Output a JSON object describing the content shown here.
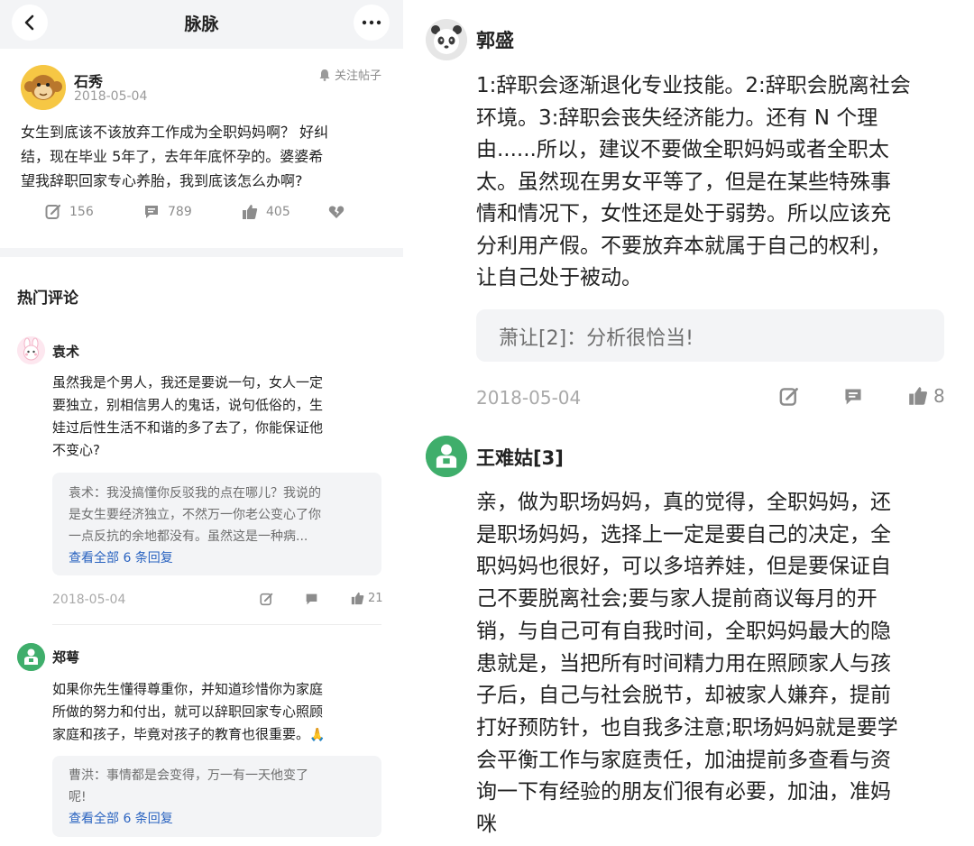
{
  "nav": {
    "title": "脉脉",
    "back_icon": "chevron-left-icon",
    "more_icon": "more-icon"
  },
  "post": {
    "author": "石秀",
    "date": "2018-05-04",
    "follow_label": "关注帖子",
    "lines": [
      "女生到底该不该放弃工作成为全职妈妈啊？ 好纠",
      "结，现在毕业 5年了，去年年底怀孕的。婆婆希",
      "望我辞职回家专心养胎，我到底该怎么办啊?"
    ],
    "stats": {
      "shares": "156",
      "comments": "789",
      "likes": "405"
    }
  },
  "hot_comments_title": "热门评论",
  "comments": [
    {
      "author": "袁术",
      "lines": [
        "虽然我是个男人，我还是要说一句，女人一定",
        "要独立，别相信男人的鬼话，说句低俗的，生",
        "娃过后性生活不和谐的多了去了，你能保证他",
        "不变心?"
      ],
      "reply_lines": [
        "袁术：我没搞懂你反驳我的点在哪儿？我说的",
        "是女生要经济独立，不然万一你老公变心了你",
        "一点反抗的余地都没有。虽然这是一种病..."
      ],
      "view_all": "查看全部 6 条回复",
      "date": "2018-05-04",
      "likes": "21"
    },
    {
      "author": "郑萼",
      "lines": [
        "如果你先生懂得尊重你，并知道珍惜你为家庭",
        "所做的努力和付出，就可以辞职回家专心照顾",
        "家庭和孩子，毕竟对孩子的教育也很重要。"
      ],
      "emoji": "🙏",
      "reply_lines": [
        "曹洪：事情都是会变得，万一有一天他变了",
        "呢!"
      ],
      "view_all": "查看全部 6 条回复"
    }
  ],
  "right_comments": [
    {
      "author": "郭盛",
      "lines": [
        "1:辞职会逐渐退化专业技能。2:辞职会脱离社会",
        "环境。3:辞职会丧失经济能力。还有 N 个理",
        "由......所以，建议不要做全职妈妈或者全职太",
        "太。虽然现在男女平等了，但是在某些特殊事",
        "情和情况下，女性还是处于弱势。所以应该充",
        "分利用产假。不要放弃本就属于自己的权利，",
        "让自己处于被动。"
      ],
      "reply": "萧让[2]：分析很恰当!",
      "date": "2018-05-04",
      "likes": "8"
    },
    {
      "author": "王难姑[3]",
      "lines": [
        "亲，做为职场妈妈，真的觉得，全职妈妈，还",
        "是职场妈妈，选择上一定是要自己的决定，全",
        "职妈妈也很好，可以多培养娃，但是要保证自",
        "己不要脱离社会;要与家人提前商议每月的开",
        "销，与自己可有自我时间，全职妈妈最大的隐",
        "患就是，当把所有时间精力用在照顾家人与孩",
        "子后，自己与社会脱节，却被家人嫌弃，提前",
        "打好预防针，也自我多注意;职场妈妈就是要学",
        "会平衡工作与家庭责任，加油提前多查看与资",
        "询一下有经验的朋友们很有必要，加油，准妈",
        "咪"
      ]
    }
  ],
  "colors": {
    "link": "#2a63c0",
    "reply_bg": "#f3f4f6",
    "muted": "#8c8c8c"
  }
}
